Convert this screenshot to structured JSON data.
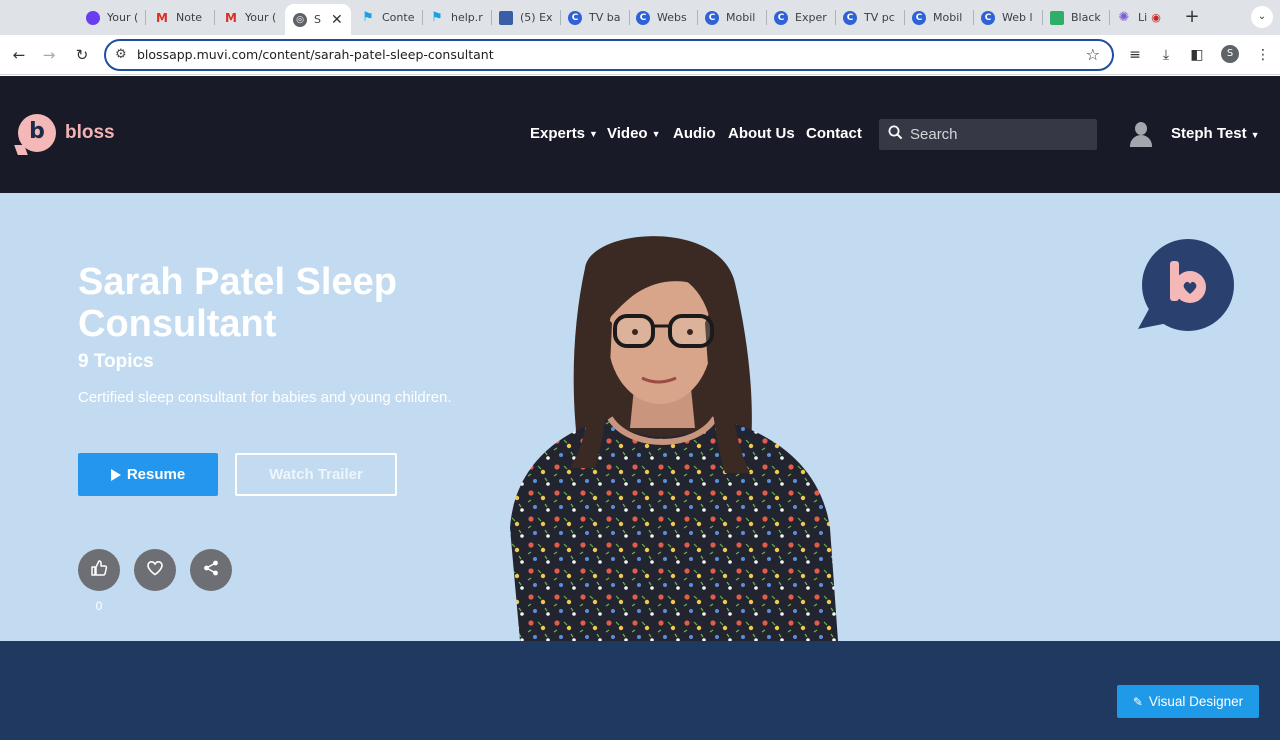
{
  "browser": {
    "tabs": [
      {
        "label": "Your (",
        "icon": "app-icon",
        "color": "#6a3df0"
      },
      {
        "label": "Note",
        "icon": "gmail-icon",
        "color": "#d93025"
      },
      {
        "label": "Your (",
        "icon": "gmail-icon",
        "color": "#d93025"
      },
      {
        "label": "S",
        "icon": "globe-icon",
        "color": "#5f6368",
        "active": true
      },
      {
        "label": "Conte",
        "icon": "flag-icon",
        "color": "#17a2e6"
      },
      {
        "label": "help.r",
        "icon": "flag-icon",
        "color": "#17a2e6"
      },
      {
        "label": "(5) Ex",
        "icon": "book-icon",
        "color": "#3a5da8"
      },
      {
        "label": "TV ba",
        "icon": "c-icon",
        "color": "#2f62d7"
      },
      {
        "label": "Webs",
        "icon": "c-icon",
        "color": "#2f62d7"
      },
      {
        "label": "Mobil",
        "icon": "c-icon",
        "color": "#2f62d7"
      },
      {
        "label": "Exper",
        "icon": "c-icon",
        "color": "#2f62d7"
      },
      {
        "label": "TV pc",
        "icon": "c-icon",
        "color": "#2f62d7"
      },
      {
        "label": "Mobil",
        "icon": "c-icon",
        "color": "#2f62d7"
      },
      {
        "label": "Web l",
        "icon": "c-icon",
        "color": "#2f62d7"
      },
      {
        "label": "Black",
        "icon": "sheet-icon",
        "color": "#2fae6a"
      },
      {
        "label": "Li",
        "icon": "spark-icon",
        "color": "#7b5cd6"
      }
    ],
    "url": "blossapp.muvi.com/content/sarah-patel-sleep-consultant",
    "profile_initial": "S"
  },
  "site": {
    "logo_text": "bloss",
    "logo_letter": "b",
    "nav": [
      {
        "label": "Experts",
        "dropdown": true
      },
      {
        "label": "Video",
        "dropdown": true
      },
      {
        "label": "Audio",
        "dropdown": false
      },
      {
        "label": "About Us",
        "dropdown": false
      },
      {
        "label": "Contact",
        "dropdown": false
      }
    ],
    "search_placeholder": "Search",
    "user_name": "Steph Test"
  },
  "hero": {
    "title": "Sarah Patel Sleep Consultant",
    "topics": "9 Topics",
    "description": "Certified sleep consultant for babies and young children.",
    "resume_label": "Resume",
    "trailer_label": "Watch Trailer",
    "like_count": "0"
  },
  "footer": {
    "visual_designer_label": "Visual Designer"
  },
  "colors": {
    "header_bg": "#181a28",
    "hero_bg": "#c2dbf1",
    "accent_blue": "#2596ee",
    "lower_band": "#1f3960",
    "logo_pink": "#f4b8b8"
  }
}
